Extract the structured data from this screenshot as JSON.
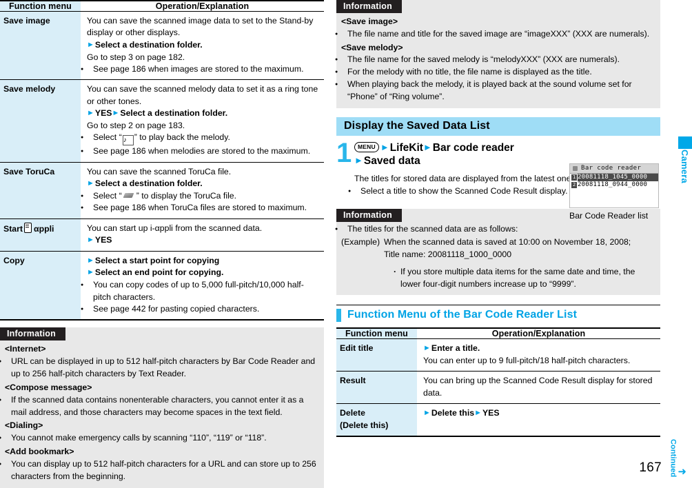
{
  "left_column": {
    "table": {
      "headers": [
        "Function menu",
        "Operation/Explanation"
      ],
      "rows": [
        {
          "menu": "Save image",
          "lines": [
            {
              "type": "text",
              "text": "You can save the scanned image data to set to the Stand-by display or other displays."
            },
            {
              "type": "arrow_bold",
              "text": "Select a destination folder."
            },
            {
              "type": "text",
              "text": "Go to step 3 on page 182."
            },
            {
              "type": "bullet",
              "text": "See page 186 when images are stored to the maximum."
            }
          ]
        },
        {
          "menu": "Save melody",
          "lines": [
            {
              "type": "text",
              "text": "You can save the scanned melody data to set it as a ring tone or other tones."
            },
            {
              "type": "arrow_double",
              "text1": "YES",
              "text2": "Select a destination folder."
            },
            {
              "type": "text",
              "text": "Go to step 2 on page 183."
            },
            {
              "type": "bullet_icon_melody",
              "pre": "Select “",
              "post": "” to play back the melody."
            },
            {
              "type": "bullet",
              "text": "See page 186 when melodies are stored to the maximum."
            }
          ]
        },
        {
          "menu": "Save ToruCa",
          "lines": [
            {
              "type": "text",
              "text": "You can save the scanned ToruCa file."
            },
            {
              "type": "arrow_bold",
              "text": "Select a destination folder."
            },
            {
              "type": "bullet_icon_toruca",
              "pre": "Select “",
              "post": "” to display the ToruCa file."
            },
            {
              "type": "bullet",
              "text": "See page 186 when ToruCa files are stored to maximum."
            }
          ]
        },
        {
          "menu_icon": "i-appli-icon",
          "menu_pre": "Start",
          "menu_post": "αppli",
          "lines": [
            {
              "type": "text",
              "text": "You can start up i-αppli from the scanned data."
            },
            {
              "type": "arrow_bold",
              "text": "YES"
            }
          ]
        },
        {
          "menu": "Copy",
          "lines": [
            {
              "type": "arrow_bold",
              "text": "Select a start point for copying"
            },
            {
              "type": "arrow_bold",
              "text": "Select an end point for copying."
            },
            {
              "type": "bullet",
              "text": "You can copy codes of up to 5,000 full-pitch/10,000 half-pitch characters."
            },
            {
              "type": "bullet",
              "text": "See page 442 for pasting copied characters."
            }
          ]
        }
      ]
    },
    "information": {
      "tab_label": "Information",
      "blocks": [
        {
          "head": "<Internet>",
          "items": [
            {
              "type": "bullet",
              "text": "URL can be displayed in up to 512 half-pitch characters by Bar Code Reader and up to 256 half-pitch characters by Text Reader."
            }
          ]
        },
        {
          "head": "<Compose message>",
          "items": [
            {
              "type": "bullet",
              "text": "If the scanned data contains nonenterable characters, you cannot enter it as a mail address, and those characters may become spaces in the text field."
            }
          ]
        },
        {
          "head": "<Dialing>",
          "items": [
            {
              "type": "bullet",
              "text": "You cannot make emergency calls by scanning “110”, “119” or “118”."
            }
          ]
        },
        {
          "head": "<Add bookmark>",
          "items": [
            {
              "type": "bullet",
              "text": "You can display up to 512 half-pitch characters for a URL and can store up to 256 characters from the beginning."
            }
          ]
        }
      ]
    }
  },
  "right_column": {
    "information_top": {
      "tab_label": "Information",
      "blocks": [
        {
          "head": "<Save image>",
          "items": [
            {
              "type": "bullet",
              "text": "The file name and title for the saved image are “imageXXX” (XXX are numerals)."
            }
          ]
        },
        {
          "head": "<Save melody>",
          "items": [
            {
              "type": "bullet",
              "text": "The file name for the saved melody is “melodyXXX” (XXX are numerals)."
            },
            {
              "type": "bullet",
              "text": "For the melody with no title, the file name is displayed as the title."
            },
            {
              "type": "bullet",
              "text": "When playing back the melody, it is played back at the sound volume set for “Phone” of “Ring volume”."
            }
          ]
        }
      ]
    },
    "section_heading": "Display the Saved Data List",
    "step": {
      "number": "1",
      "menu_key": "MENU",
      "title_part1": "LifeKit",
      "title_part2": "Bar code reader",
      "title_part3": "Saved data",
      "desc": "The titles for stored data are displayed from the latest one.",
      "bullet": "Select a title to show the Scanned Code Result display."
    },
    "phone_mock": {
      "title": "Bar code reader",
      "rows": [
        {
          "index": "1",
          "label": "20081118_1045_0000",
          "selected": true
        },
        {
          "index": "2",
          "label": "20081118_0944_0000",
          "selected": false
        }
      ],
      "caption": "Bar Code Reader list"
    },
    "information_mid": {
      "tab_label": "Information",
      "lead": "The titles for the scanned data are as follows:",
      "example_label": "(Example)",
      "example_line1": "When the scanned data is saved at 10:00 on November 18, 2008;",
      "example_line2": "Title name: 20081118_1000_0000",
      "sub_item": "If you store multiple data items for the same date and time, the lower four-digit numbers increase up to “9999”."
    },
    "function_menu_heading": "Function Menu of the Bar Code Reader List",
    "table": {
      "headers": [
        "Function menu",
        "Operation/Explanation"
      ],
      "rows": [
        {
          "menu": "Edit title",
          "lines": [
            {
              "type": "arrow_bold",
              "text": "Enter a title."
            },
            {
              "type": "text",
              "text": "You can enter up to 9 full-pitch/18 half-pitch characters."
            }
          ]
        },
        {
          "menu": "Result",
          "lines": [
            {
              "type": "text",
              "text": "You can bring up the Scanned Code Result display for stored data."
            }
          ]
        },
        {
          "menu": "Delete",
          "menu_line2": "(Delete this)",
          "lines": [
            {
              "type": "arrow_double",
              "text1": "Delete this",
              "text2": "YES"
            }
          ]
        }
      ]
    }
  },
  "side_tab": {
    "label": "Camera"
  },
  "footer": {
    "page_number": "167",
    "continued_label": "Continued",
    "arrow": "➜"
  },
  "colors": {
    "accent_cyan": "#00a8e8",
    "heading_fill": "#9fddf6",
    "table_menu_bg": "#d9eef8",
    "info_bg": "#e8e8e8",
    "info_tab_bg": "#231f20"
  }
}
